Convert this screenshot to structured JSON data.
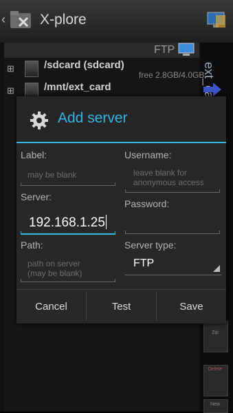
{
  "app": {
    "title": "X-plore"
  },
  "background": {
    "ftp_label": "FTP",
    "rows": [
      {
        "name": "/sdcard (sdcard)",
        "sub": "free 2.8GB/4.0GB"
      },
      {
        "name": "/mnt/ext_card",
        "sub": ""
      }
    ],
    "side_panel_label": "ext_card",
    "side_buttons": [
      "Zip",
      "Delete",
      "New"
    ]
  },
  "dialog": {
    "title": "Add server",
    "label": {
      "label": "Label:",
      "placeholder": "may be blank"
    },
    "username": {
      "label": "Username:",
      "placeholder_line1": "leave blank for",
      "placeholder_line2": "anonymous access"
    },
    "server": {
      "label": "Server:",
      "value": "192.168.1.25"
    },
    "password": {
      "label": "Password:",
      "value": ""
    },
    "path": {
      "label": "Path:",
      "placeholder_line1": "path on server",
      "placeholder_line2": "(may be blank)"
    },
    "server_type": {
      "label": "Server type:",
      "value": "FTP"
    },
    "buttons": {
      "cancel": "Cancel",
      "test": "Test",
      "save": "Save"
    }
  },
  "colors": {
    "accent": "#33b5e5"
  }
}
